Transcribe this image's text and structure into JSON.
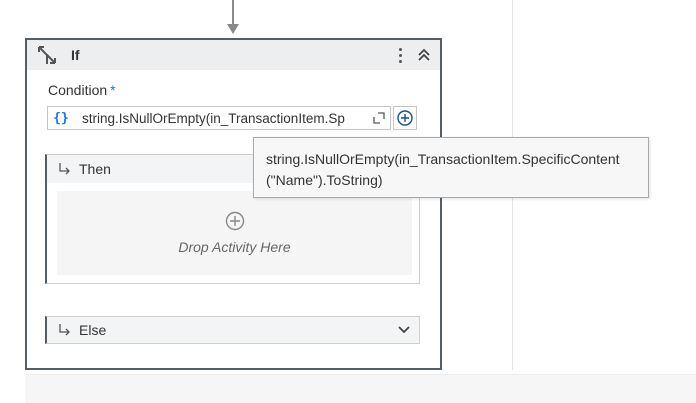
{
  "activity": {
    "title": "If",
    "icon": "if-branch-icon"
  },
  "condition": {
    "label": "Condition",
    "required_marker": "*",
    "value": "string.IsNullOrEmpty(in_TransactionItem.Sp",
    "brace_glyph": "{}"
  },
  "then_branch": {
    "label": "Then",
    "drop_text": "Drop Activity Here"
  },
  "else_branch": {
    "label": "Else"
  },
  "tooltip": {
    "text": "string.IsNullOrEmpty(in_TransactionItem.SpecificContent (\"Name\").ToString)"
  },
  "colors": {
    "accent": "#1a73e8",
    "activity_border": "#545e66",
    "header_bg": "#eceeef"
  }
}
